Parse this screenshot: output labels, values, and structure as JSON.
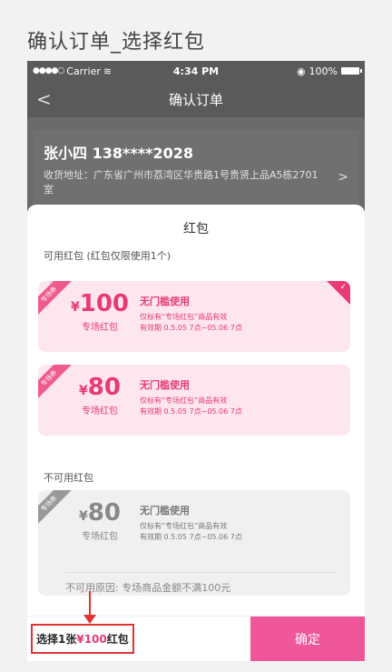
{
  "page_title": "确认订单_选择红包",
  "status_bar": {
    "carrier": "Carrier",
    "time": "4:34 PM",
    "battery": "100%"
  },
  "nav": {
    "back": "<",
    "title": "确认订单"
  },
  "address": {
    "name": "张小四  138****2028",
    "line": "收货地址：广东省广州市荔湾区华贵路1号贵贤上品A5栋2701室",
    "arrow": ">"
  },
  "sheet": {
    "title": "红包",
    "available_label": "可用红包 (红包仅限使用1个)",
    "unavailable_label": "不可用红包",
    "coupons_available": [
      {
        "ribbon": "专场券",
        "currency": "¥",
        "amount": "100",
        "type": "专场红包",
        "name": "无门槛使用",
        "desc1": "仅标有“专场红包”商品有效",
        "desc2": "有效期 0.5.05 7点~05.06 7点",
        "selected": true
      },
      {
        "ribbon": "专场券",
        "currency": "¥",
        "amount": "80",
        "type": "专场红包",
        "name": "无门槛使用",
        "desc1": "仅标有“专场红包”商品有效",
        "desc2": "有效期 0.5.05 7点~05.06 7点",
        "selected": false
      }
    ],
    "coupon_unavailable": {
      "ribbon": "专场券",
      "currency": "¥",
      "amount": "80",
      "type": "专场红包",
      "name": "无门槛使用",
      "desc1": "仅标有“专场红包”商品有效",
      "desc2": "有效期 0.5.05 7点~05.06 7点",
      "reason": "不可用原因: 专场商品金额不满100元"
    }
  },
  "bottom": {
    "select_prefix": "选择1张",
    "select_amount": "¥100",
    "select_suffix": "红包",
    "confirm_label": "确定"
  },
  "colors": {
    "accent": "#e83b73",
    "confirm_bg": "#f0569a",
    "highlight_red": "#e23333"
  }
}
